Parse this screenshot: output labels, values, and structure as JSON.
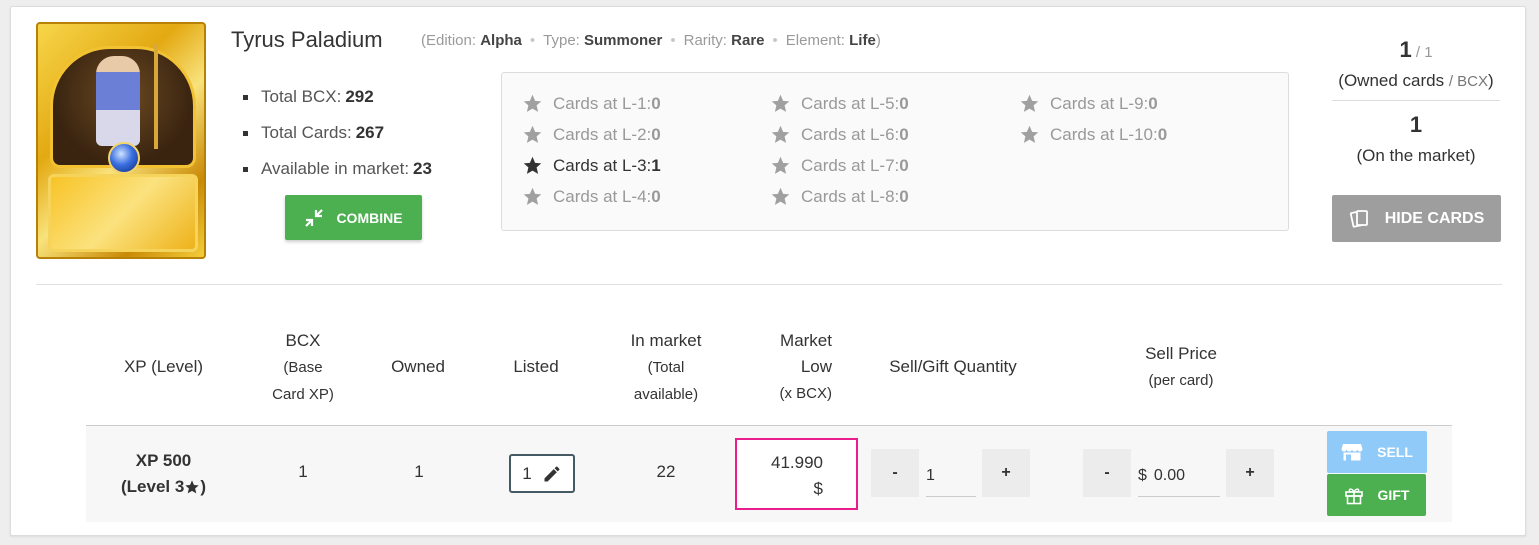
{
  "card": {
    "name": "Tyrus Paladium",
    "meta_open": "(",
    "meta_close": ")",
    "edition_label": "Edition: ",
    "edition": "Alpha",
    "type_label": "Type: ",
    "type": "Summoner",
    "rarity_label": "Rarity: ",
    "rarity": "Rare",
    "element_label": "Element: ",
    "element": "Life"
  },
  "stats": {
    "total_bcx_label": "Total BCX:",
    "total_bcx": "292",
    "total_cards_label": "Total Cards:",
    "total_cards": "267",
    "available_label": "Available in market:",
    "available": "23"
  },
  "combine_label": "COMBINE",
  "levels": [
    {
      "label": "Cards at L-1: ",
      "count": "0",
      "owned": false
    },
    {
      "label": "Cards at L-2: ",
      "count": "0",
      "owned": false
    },
    {
      "label": "Cards at L-3: ",
      "count": "1",
      "owned": true
    },
    {
      "label": "Cards at L-4: ",
      "count": "0",
      "owned": false
    },
    {
      "label": "Cards at L-5: ",
      "count": "0",
      "owned": false
    },
    {
      "label": "Cards at L-6: ",
      "count": "0",
      "owned": false
    },
    {
      "label": "Cards at L-7: ",
      "count": "0",
      "owned": false
    },
    {
      "label": "Cards at L-8: ",
      "count": "0",
      "owned": false
    },
    {
      "label": "Cards at L-9: ",
      "count": "0",
      "owned": false
    },
    {
      "label": "Cards at L-10: ",
      "count": "0",
      "owned": false
    }
  ],
  "owned": {
    "count": "1",
    "bcx": " / 1",
    "label_open": "(Owned cards ",
    "label_bcx": "/ BCX",
    "label_close": ")",
    "market_count": "1",
    "market_label": "(On the market)"
  },
  "hide_cards_label": "HIDE CARDS",
  "table": {
    "headers": {
      "xp": "XP (Level)",
      "bcx_1": "BCX",
      "bcx_2": "(Base",
      "bcx_3": "Card XP)",
      "owned": "Owned",
      "listed": "Listed",
      "in_market_1": "In market",
      "in_market_2": "(Total",
      "in_market_3": "available)",
      "market_low_1": "Market",
      "market_low_2": "Low",
      "market_low_3": "(x BCX)",
      "quantity": "Sell/Gift Quantity",
      "sell_price_1": "Sell Price",
      "sell_price_2": "(per card)"
    },
    "row": {
      "xp": "XP 500",
      "level": "(Level 3 ",
      "level_close": ")",
      "bcx": "1",
      "owned": "1",
      "listed": "1",
      "in_market": "22",
      "market_low": "41.990",
      "market_low_currency": "$",
      "quantity": "1",
      "price_currency": "$",
      "price": "0.00"
    },
    "minus_label": "-",
    "plus_label": "+",
    "sell_label": "SELL",
    "gift_label": "GIFT"
  },
  "colors": {
    "combine": "#4caf50",
    "hide": "#9e9e9e",
    "sell": "#90caf9",
    "gift": "#4caf50",
    "highlight": "#e91e8c"
  }
}
